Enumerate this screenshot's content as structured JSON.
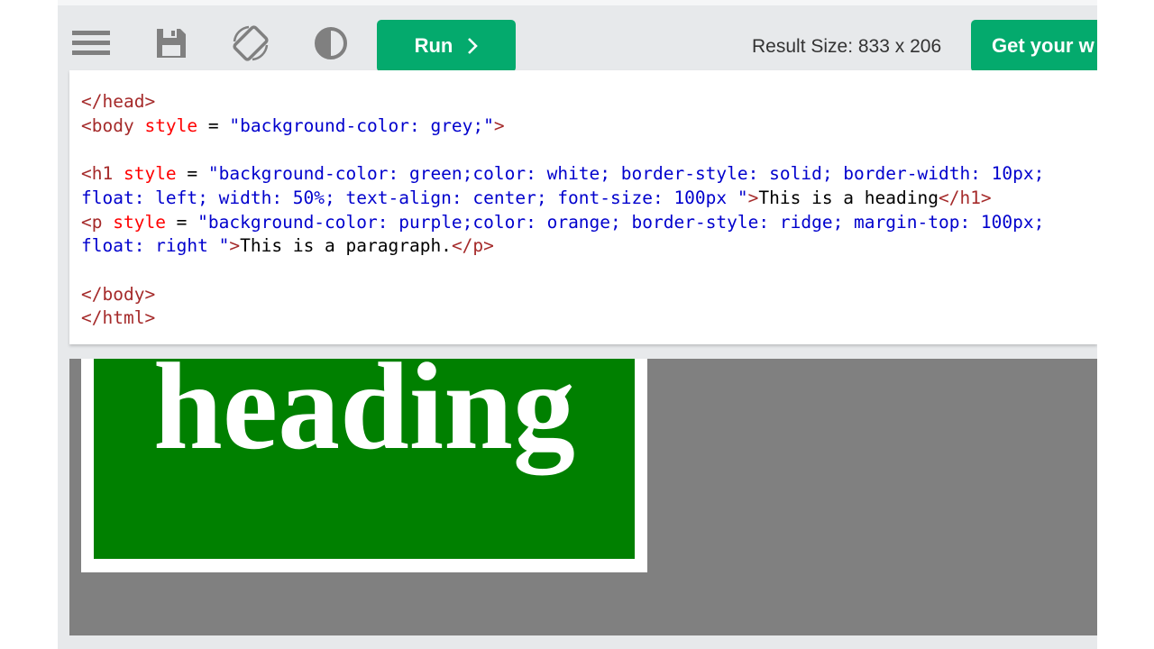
{
  "toolbar": {
    "icons": [
      "menu-icon",
      "save-icon",
      "rotate-icon",
      "contrast-icon"
    ],
    "run_label": "Run",
    "run_icon": "chevron-right-icon",
    "result_size": "Result Size: 833 x 206",
    "get_label": "Get your w"
  },
  "editor": {
    "lines": [
      [
        {
          "t": "tag",
          "v": "</head>"
        }
      ],
      [
        {
          "t": "tag",
          "v": "<body "
        },
        {
          "t": "attr",
          "v": "style"
        },
        {
          "t": "txt",
          "v": " = "
        },
        {
          "t": "val",
          "v": "\"background-color: grey;\""
        },
        {
          "t": "tag",
          "v": ">"
        }
      ],
      [],
      [
        {
          "t": "tag",
          "v": "<h1 "
        },
        {
          "t": "attr",
          "v": "style"
        },
        {
          "t": "txt",
          "v": " = "
        },
        {
          "t": "val",
          "v": "\"background-color: green;color: white; border-style: solid; border-width: 10px;"
        }
      ],
      [
        {
          "t": "val",
          "v": "float: left; width: 50%; text-align: center; font-size: 100px \""
        },
        {
          "t": "tag",
          "v": ">"
        },
        {
          "t": "txt",
          "v": "This is a heading"
        },
        {
          "t": "tag",
          "v": "</h1>"
        }
      ],
      [
        {
          "t": "tag",
          "v": "<p "
        },
        {
          "t": "attr",
          "v": "style"
        },
        {
          "t": "txt",
          "v": " = "
        },
        {
          "t": "val",
          "v": "\"background-color: purple;color: orange; border-style: ridge; margin-top: 100px;"
        }
      ],
      [
        {
          "t": "val",
          "v": "float: right \""
        },
        {
          "t": "tag",
          "v": ">"
        },
        {
          "t": "txt",
          "v": "This is a paragraph."
        },
        {
          "t": "tag",
          "v": "</p>"
        }
      ],
      [],
      [
        {
          "t": "tag",
          "v": "</body>"
        }
      ],
      [
        {
          "t": "tag",
          "v": "</html>"
        }
      ]
    ]
  },
  "result": {
    "heading_text": "This is a heading",
    "colors": {
      "background": "#808080",
      "heading_bg": "#008000",
      "heading_fg": "#ffffff"
    }
  },
  "colors": {
    "accent": "#04aa6d",
    "toolbar_bg": "#e7e9eb",
    "icon": "#808080"
  }
}
